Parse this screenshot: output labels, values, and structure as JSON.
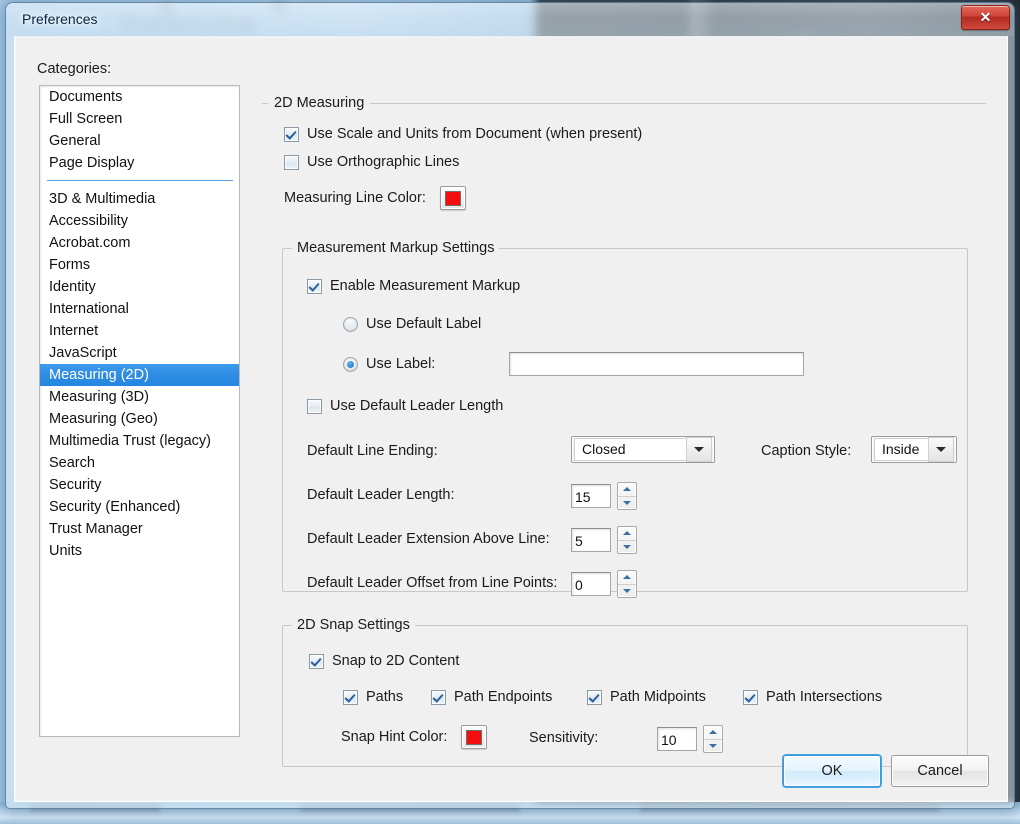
{
  "window": {
    "title": "Preferences",
    "close_label": "✕"
  },
  "sidebar": {
    "label": "Categories:",
    "group1": [
      {
        "label": "Documents",
        "selected": false
      },
      {
        "label": "Full Screen",
        "selected": false
      },
      {
        "label": "General",
        "selected": false
      },
      {
        "label": "Page Display",
        "selected": false
      }
    ],
    "group2": [
      {
        "label": "3D & Multimedia",
        "selected": false
      },
      {
        "label": "Accessibility",
        "selected": false
      },
      {
        "label": "Acrobat.com",
        "selected": false
      },
      {
        "label": "Forms",
        "selected": false
      },
      {
        "label": "Identity",
        "selected": false
      },
      {
        "label": "International",
        "selected": false
      },
      {
        "label": "Internet",
        "selected": false
      },
      {
        "label": "JavaScript",
        "selected": false
      },
      {
        "label": "Measuring (2D)",
        "selected": true
      },
      {
        "label": "Measuring (3D)",
        "selected": false
      },
      {
        "label": "Measuring (Geo)",
        "selected": false
      },
      {
        "label": "Multimedia Trust (legacy)",
        "selected": false
      },
      {
        "label": "Search",
        "selected": false
      },
      {
        "label": "Security",
        "selected": false
      },
      {
        "label": "Security (Enhanced)",
        "selected": false
      },
      {
        "label": "Trust Manager",
        "selected": false
      },
      {
        "label": "Units",
        "selected": false
      }
    ]
  },
  "measuring_2d": {
    "legend": "2D Measuring",
    "use_scale_units": {
      "label": "Use Scale and Units from Document (when present)",
      "checked": true
    },
    "use_orthographic": {
      "label": "Use Orthographic Lines",
      "checked": false
    },
    "line_color": {
      "label": "Measuring Line Color:",
      "value": "#f40d0d"
    }
  },
  "markup": {
    "legend": "Measurement Markup Settings",
    "enable": {
      "label": "Enable Measurement Markup",
      "checked": true
    },
    "use_default_label": {
      "label": "Use Default Label",
      "selected": false
    },
    "use_label": {
      "label": "Use Label:",
      "selected": true,
      "value": "",
      "placeholder": ""
    },
    "use_default_leader_length": {
      "label": "Use Default Leader Length",
      "checked": false
    },
    "line_ending": {
      "label": "Default Line Ending:",
      "value": "Closed"
    },
    "caption_style": {
      "label": "Caption Style:",
      "value": "Inside"
    },
    "leader_length": {
      "label": "Default Leader Length:",
      "value": "15"
    },
    "leader_extension": {
      "label": "Default Leader Extension Above Line:",
      "value": "5"
    },
    "leader_offset": {
      "label": "Default Leader Offset from Line Points:",
      "value": "0"
    }
  },
  "snap": {
    "legend": "2D Snap Settings",
    "snap_to_2d": {
      "label": "Snap to 2D Content",
      "checked": true
    },
    "options": [
      {
        "label": "Paths",
        "checked": true
      },
      {
        "label": "Path Endpoints",
        "checked": true
      },
      {
        "label": "Path Midpoints",
        "checked": true
      },
      {
        "label": "Path Intersections",
        "checked": true
      }
    ],
    "hint_color": {
      "label": "Snap Hint Color:",
      "value": "#f40d0d"
    },
    "sensitivity": {
      "label": "Sensitivity:",
      "value": "10"
    }
  },
  "footer": {
    "ok": "OK",
    "cancel": "Cancel"
  }
}
